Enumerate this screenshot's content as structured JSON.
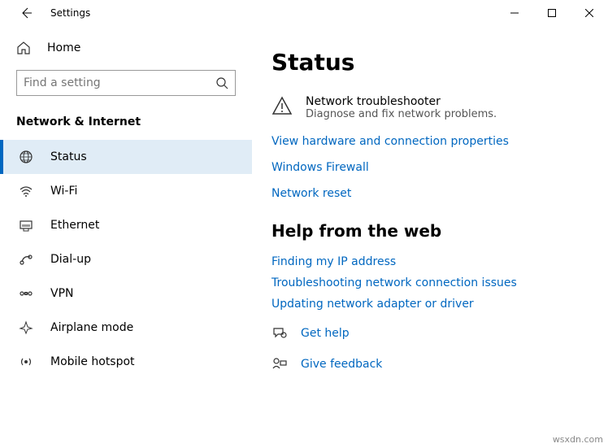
{
  "titlebar": {
    "title": "Settings"
  },
  "sidebar": {
    "home_label": "Home",
    "search_placeholder": "Find a setting",
    "section_header": "Network & Internet",
    "items": [
      {
        "label": "Status"
      },
      {
        "label": "Wi-Fi"
      },
      {
        "label": "Ethernet"
      },
      {
        "label": "Dial-up"
      },
      {
        "label": "VPN"
      },
      {
        "label": "Airplane mode"
      },
      {
        "label": "Mobile hotspot"
      }
    ]
  },
  "main": {
    "page_title": "Status",
    "troubleshooter": {
      "title": "Network troubleshooter",
      "desc": "Diagnose and fix network problems."
    },
    "links": [
      "View hardware and connection properties",
      "Windows Firewall",
      "Network reset"
    ],
    "help_header": "Help from the web",
    "help_links": [
      "Finding my IP address",
      "Troubleshooting network connection issues",
      "Updating network adapter or driver"
    ],
    "footer": {
      "get_help": "Get help",
      "give_feedback": "Give feedback"
    }
  },
  "watermark": "wsxdn.com"
}
